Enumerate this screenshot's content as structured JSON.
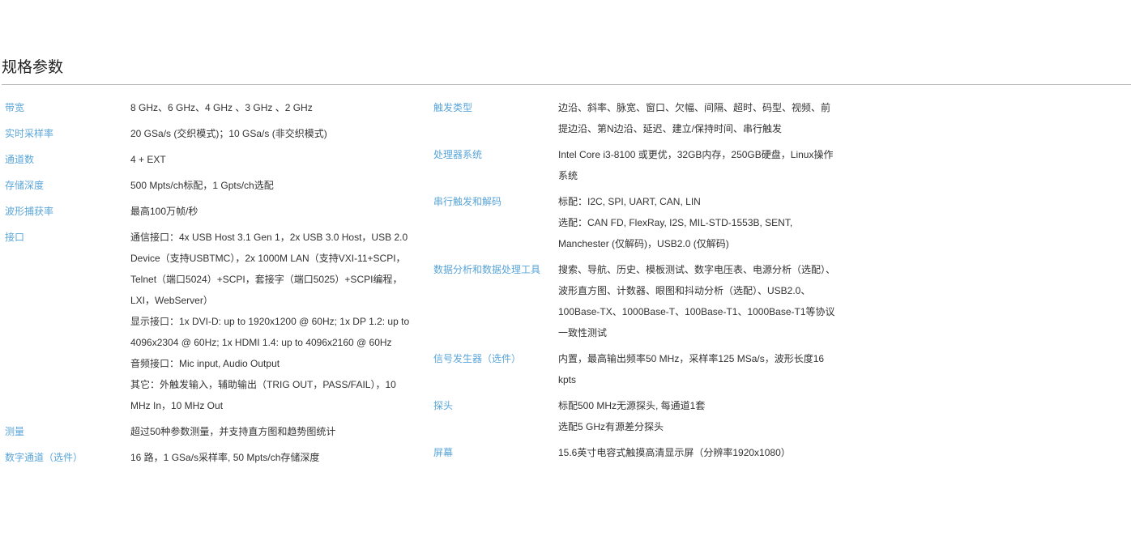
{
  "section": {
    "title": "规格参数"
  },
  "left": [
    {
      "label": "带宽",
      "lines": [
        "8 GHz、6 GHz、4 GHz 、3 GHz 、2 GHz"
      ]
    },
    {
      "label": "实时采样率",
      "lines": [
        "20 GSa/s (交织模式)；10 GSa/s (非交织模式)"
      ]
    },
    {
      "label": "通道数",
      "lines": [
        "4 + EXT"
      ]
    },
    {
      "label": "存储深度",
      "lines": [
        "500 Mpts/ch标配，1 Gpts/ch选配"
      ]
    },
    {
      "label": "波形捕获率",
      "lines": [
        "最高100万帧/秒"
      ]
    },
    {
      "label": "接口",
      "lines": [
        "通信接口：4x USB Host 3.1 Gen 1，2x USB 3.0 Host，USB 2.0 Device（支持USBTMC），2x 1000M LAN（支持VXI-11+SCPI， Telnet（端口5024）+SCPI，套接字（端口5025）+SCPI编程，LXI，WebServer）",
        "显示接口：1x DVI-D: up to 1920x1200 @ 60Hz; 1x DP 1.2: up to 4096x2304 @ 60Hz; 1x HDMI 1.4: up to 4096x2160 @ 60Hz",
        "音频接口：Mic input, Audio Output",
        "其它：外触发输入，辅助输出（TRIG OUT，PASS/FAIL），10 MHz In，10 MHz Out"
      ]
    },
    {
      "label": "测量",
      "lines": [
        "超过50种参数测量，并支持直方图和趋势图统计"
      ]
    },
    {
      "label": "数字通道（选件）",
      "lines": [
        "16 路，1 GSa/s采样率, 50 Mpts/ch存储深度"
      ]
    }
  ],
  "right": [
    {
      "label": "触发类型",
      "lines": [
        "边沿、斜率、脉宽、窗口、欠幅、间隔、超时、码型、视频、前提边沿、第N边沿、延迟、建立/保持时间、串行触发"
      ]
    },
    {
      "label": "处理器系统",
      "lines": [
        "Intel Core i3-8100 或更优，32GB内存，250GB硬盘，Linux操作系统"
      ]
    },
    {
      "label": "串行触发和解码",
      "lines": [
        "标配：I2C, SPI, UART, CAN, LIN",
        "选配：CAN FD, FlexRay, I2S, MIL-STD-1553B, SENT, Manchester (仅解码)，USB2.0 (仅解码)"
      ]
    },
    {
      "label": "数据分析和数据处理工具",
      "lines": [
        "搜索、导航、历史、模板测试、数字电压表、电源分析（选配）、波形直方图、计数器、眼图和抖动分析（选配）、USB2.0、100Base-TX、1000Base-T、100Base-T1、1000Base-T1等协议一致性测试"
      ]
    },
    {
      "label": "信号发生器（选件）",
      "lines": [
        "内置，最高输出频率50 MHz，采样率125 MSa/s，波形长度16 kpts"
      ]
    },
    {
      "label": "探头",
      "lines": [
        "标配500 MHz无源探头, 每通道1套",
        "选配5 GHz有源差分探头"
      ]
    },
    {
      "label": "屏幕",
      "lines": [
        "15.6英寸电容式触摸高清显示屏（分辨率1920x1080）"
      ]
    }
  ]
}
